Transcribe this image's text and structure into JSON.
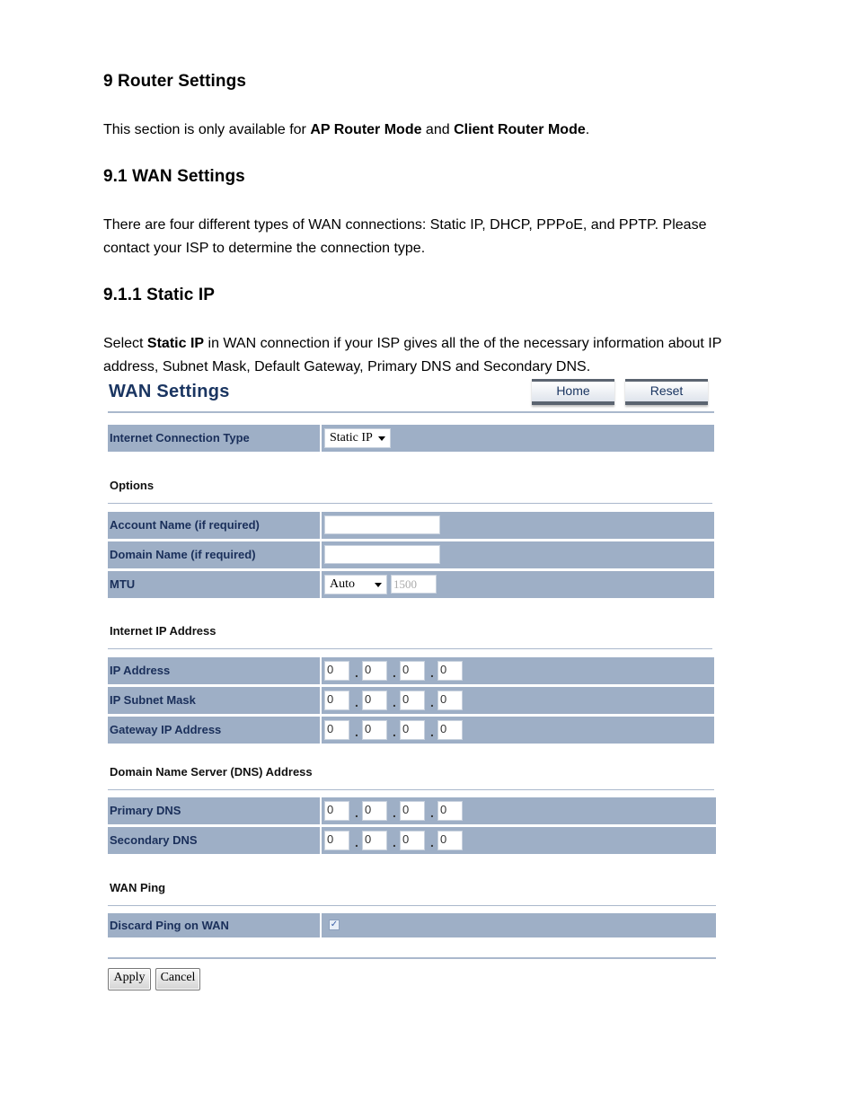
{
  "document": {
    "heading_main": "9 Router Settings",
    "intro": {
      "prefix": "This section is only available for ",
      "bold1": "AP Router Mode",
      "mid": " and ",
      "bold2": "Client Router Mode",
      "suffix": "."
    },
    "heading_wan": "9.1 WAN Settings",
    "wan_paragraph": "There are four different types of WAN connections: Static IP, DHCP, PPPoE, and PPTP. Please contact your ISP to determine the connection type.",
    "heading_static": "9.1.1 Static IP",
    "static_paragraph": {
      "prefix": "Select ",
      "bold": "Static IP",
      "suffix": " in WAN connection if your ISP gives all the of the necessary information about IP address, Subnet Mask, Default Gateway, Primary DNS and Secondary DNS."
    }
  },
  "screenshot": {
    "title": "WAN Settings",
    "home_button": "Home",
    "reset_button": "Reset",
    "connection_type": {
      "label": "Internet Connection Type",
      "selected": "Static IP"
    },
    "options": {
      "section_title": "Options",
      "account_name_label": "Account Name (if required)",
      "account_name_value": "",
      "domain_name_label": "Domain Name (if required)",
      "domain_name_value": "",
      "mtu_label": "MTU",
      "mtu_mode": "Auto",
      "mtu_value": "1500"
    },
    "internet_ip": {
      "section_title": "Internet IP Address",
      "rows": [
        {
          "label": "IP Address",
          "octets": [
            "0",
            "0",
            "0",
            "0"
          ]
        },
        {
          "label": "IP Subnet Mask",
          "octets": [
            "0",
            "0",
            "0",
            "0"
          ]
        },
        {
          "label": "Gateway IP Address",
          "octets": [
            "0",
            "0",
            "0",
            "0"
          ]
        }
      ]
    },
    "dns": {
      "section_title": "Domain Name Server (DNS) Address",
      "rows": [
        {
          "label": "Primary DNS",
          "octets": [
            "0",
            "0",
            "0",
            "0"
          ]
        },
        {
          "label": "Secondary DNS",
          "octets": [
            "0",
            "0",
            "0",
            "0"
          ]
        }
      ]
    },
    "wan_ping": {
      "section_title": "WAN Ping",
      "discard_label": "Discard Ping on WAN",
      "discard_checked": true,
      "check_glyph": "✓"
    },
    "apply_button": "Apply",
    "cancel_button": "Cancel"
  }
}
